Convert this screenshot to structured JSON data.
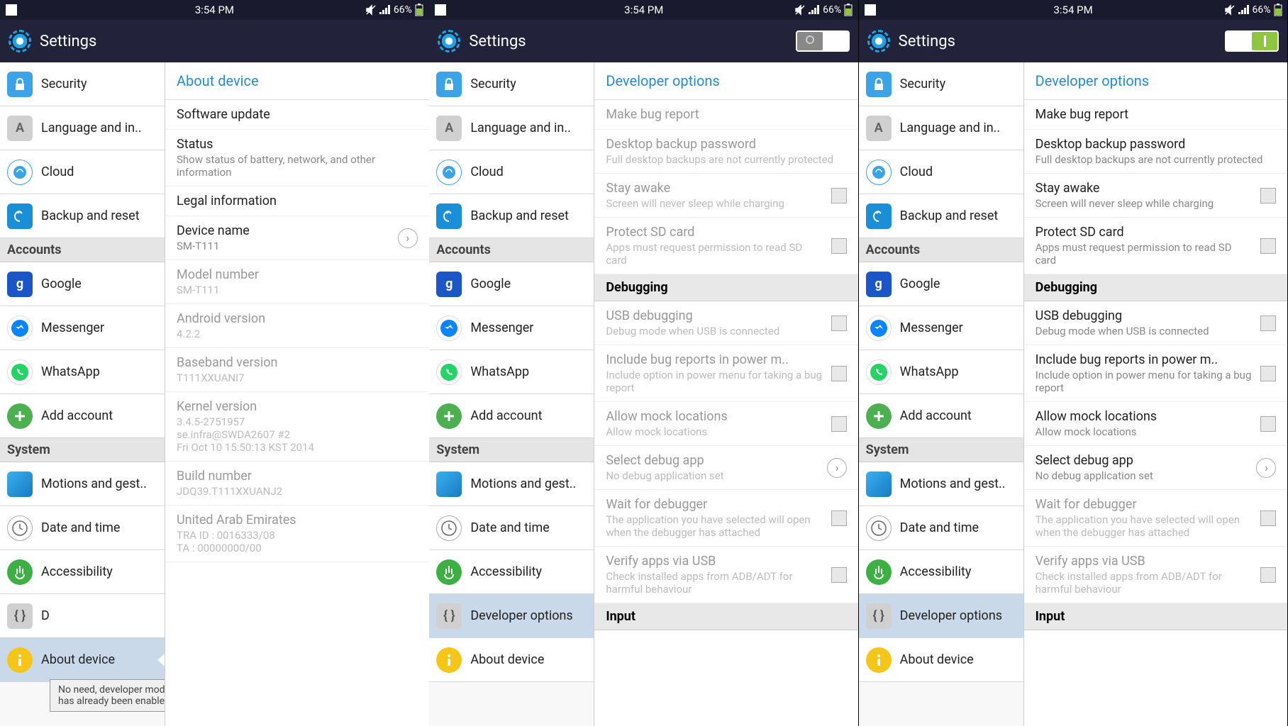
{
  "status": {
    "time": "3:54 PM",
    "battery": "66%"
  },
  "header": {
    "title": "Settings"
  },
  "sidebar": {
    "items": [
      {
        "label": "Security"
      },
      {
        "label": "Language and in.."
      },
      {
        "label": "Cloud"
      },
      {
        "label": "Backup and reset"
      }
    ],
    "sec_accounts": "Accounts",
    "accounts": [
      {
        "label": "Google"
      },
      {
        "label": "Messenger"
      },
      {
        "label": "WhatsApp"
      },
      {
        "label": "Add account"
      }
    ],
    "sec_system": "System",
    "system": [
      {
        "label": "Motions and gest.."
      },
      {
        "label": "Date and time"
      },
      {
        "label": "Accessibility"
      },
      {
        "label": "Developer options"
      },
      {
        "label": "About device"
      }
    ],
    "dshort": "D"
  },
  "about": {
    "title": "About device",
    "rows": [
      {
        "t1": "Software update"
      },
      {
        "t1": "Status",
        "t2": "Show status of battery, network, and other information"
      },
      {
        "t1": "Legal information"
      },
      {
        "t1": "Device name",
        "t2": "SM-T111",
        "chev": true
      },
      {
        "t1": "Model number",
        "t2": "SM-T111",
        "dis": true
      },
      {
        "t1": "Android version",
        "t2": "4.2.2",
        "dis": true
      },
      {
        "t1": "Baseband version",
        "t2": "T111XXUANI7",
        "dis": true
      },
      {
        "t1": "Kernel version",
        "t2": "3.4.5-2751957\nse.infra@SWDA2607 #2\nFri Oct 10 15:50:13 KST 2014",
        "dis": true
      },
      {
        "t1": "Build number",
        "t2": "JDQ39.T111XXUANJ2",
        "dis": true
      },
      {
        "t1": "United Arab Emirates",
        "t2": "TRA ID : 0016333/08\nTA : 00000000/00",
        "dis": true
      }
    ]
  },
  "dev": {
    "title": "Developer options",
    "rows": [
      {
        "t1": "Make bug report"
      },
      {
        "t1": "Desktop backup password",
        "t2": "Full desktop backups are not currently protected"
      },
      {
        "t1": "Stay awake",
        "t2": "Screen will never sleep while charging",
        "cb": true
      },
      {
        "t1": "Protect SD card",
        "t2": "Apps must request permission to read SD card",
        "cb": true
      }
    ],
    "sec_debug": "Debugging",
    "debug": [
      {
        "t1": "USB debugging",
        "t2": "Debug mode when USB is connected",
        "cb": true
      },
      {
        "t1": "Include bug reports in power m..",
        "t2": "Include option in power menu for taking a bug report",
        "cb": true
      },
      {
        "t1": "Allow mock locations",
        "t2": "Allow mock locations",
        "cb": true
      },
      {
        "t1": "Select debug app",
        "t2": "No debug application set",
        "chev": true
      },
      {
        "t1": "Wait for debugger",
        "t2": "The application you have selected will open when the debugger has attached",
        "cb": true,
        "dis": true
      },
      {
        "t1": "Verify apps via USB",
        "t2": "Check installed apps from ADB/ADT for harmful behaviour",
        "cb": true,
        "dis": true
      }
    ],
    "sec_input": "Input"
  },
  "toast": "No need, developer mode has already been enabled"
}
